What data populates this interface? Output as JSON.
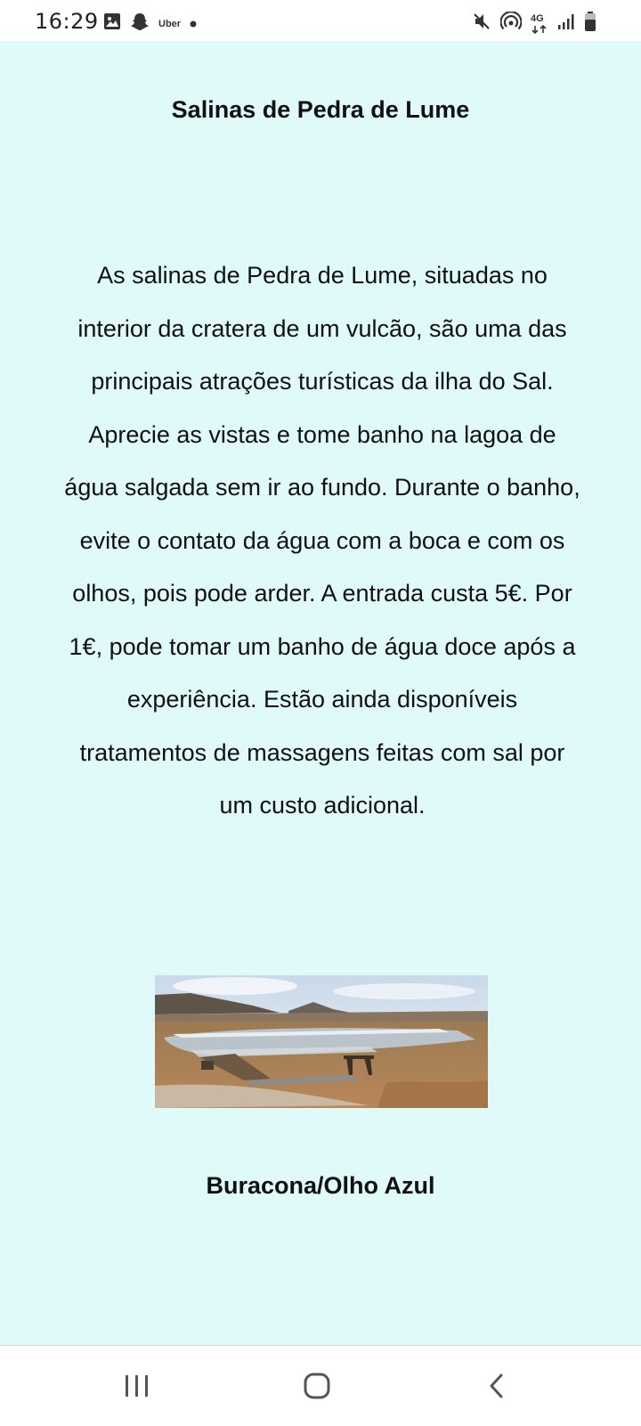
{
  "status_bar": {
    "time": "16:29",
    "notification_icons": [
      "image-icon",
      "snapchat-icon",
      "uber-icon",
      "dot-icon"
    ],
    "uber_label": "Uber",
    "network_label": "4G",
    "system_icons": [
      "mute-icon",
      "hotspot-icon",
      "network-4g-icon",
      "signal-icon",
      "battery-icon"
    ]
  },
  "page": {
    "background": "#e0fafa",
    "section1": {
      "title": "Salinas de Pedra de Lume",
      "description": "As salinas de Pedra de Lume, situadas no interior da cratera de um vulcão, são uma das principais atrações turísticas da ilha do Sal. Aprecie as vistas e tome banho na lagoa de água salgada sem ir ao fundo. Durante o banho, evite o contato da água com a boca e com os olhos, pois pode arder. A entrada custa 5€. Por 1€, pode tomar um banho de água doce após a experiência. Estão ainda disponíveis tratamentos de massagens feitas com sal por um custo adicional."
    },
    "section2": {
      "title": "Buracona/Olho Azul"
    }
  },
  "nav_bar": {
    "buttons": [
      "recent-apps-icon",
      "home-icon",
      "back-icon"
    ]
  }
}
